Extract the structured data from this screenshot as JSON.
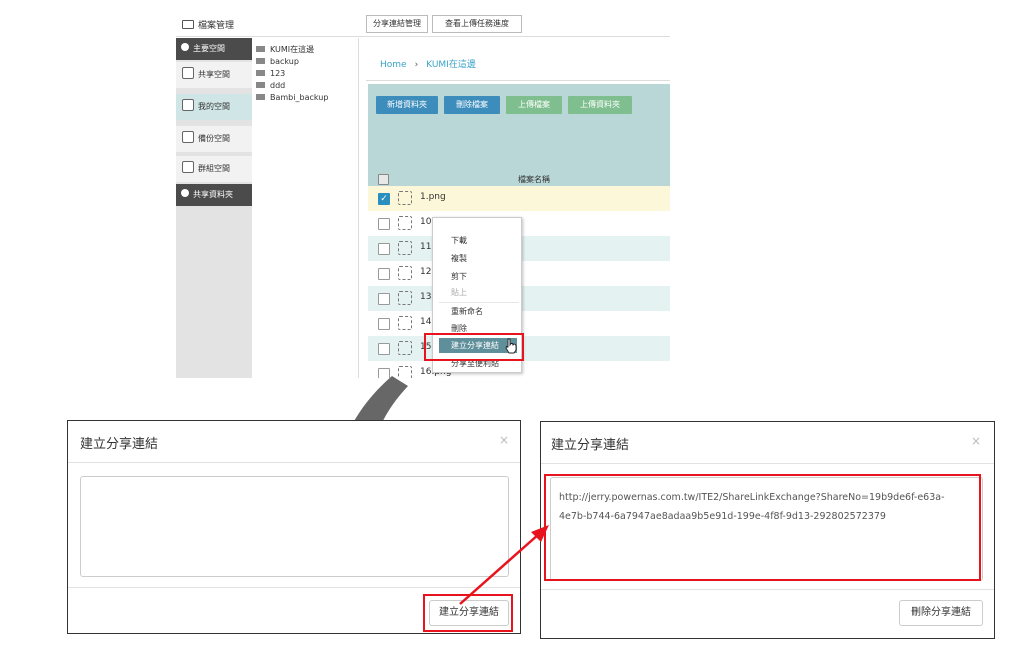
{
  "file_manager": {
    "title": "檔案管理",
    "top_buttons": [
      "分享連結管理",
      "查看上傳任務進度"
    ],
    "sidebar": [
      {
        "label": "主要空間",
        "icon": "pie-chart-icon",
        "style": "dark"
      },
      {
        "label": "共享空間",
        "icon": "globe-icon",
        "style": "light"
      },
      {
        "label": "我的空間",
        "icon": "home-icon",
        "style": "selected"
      },
      {
        "label": "備份空間",
        "icon": "history-icon",
        "style": "light"
      },
      {
        "label": "群組空間",
        "icon": "group-icon",
        "style": "light"
      },
      {
        "label": "共享資料夾",
        "icon": "pie-chart-icon",
        "style": "dark"
      }
    ],
    "tree": [
      "KUMI在這邊",
      "backup",
      "123",
      "ddd",
      "Bambi_backup"
    ],
    "breadcrumb": [
      "Home",
      "KUMI在這邊"
    ],
    "breadcrumb_sep": "›",
    "toolbar": [
      "新增資料夾",
      "刪除檔案",
      "上傳檔案",
      "上傳資料夾"
    ],
    "column_header": "檔案名稱",
    "files": [
      {
        "name": "1.png",
        "checked": true
      },
      {
        "name": "10",
        "checked": false
      },
      {
        "name": "11",
        "checked": false
      },
      {
        "name": "12",
        "checked": false
      },
      {
        "name": "13",
        "checked": false
      },
      {
        "name": "14",
        "checked": false
      },
      {
        "name": "15",
        "checked": false
      },
      {
        "name": "16.png",
        "checked": false
      }
    ],
    "context_menu": [
      "下載",
      "複製",
      "剪下",
      "貼上",
      "重新命名",
      "刪除",
      "建立分享連結",
      "分享至便利貼"
    ],
    "checkmark": "✓"
  },
  "dialog_empty": {
    "title": "建立分享連結",
    "close": "×",
    "button": "建立分享連結"
  },
  "dialog_result": {
    "title": "建立分享連結",
    "close": "×",
    "url_line1": "http://jerry.powernas.com.tw/ITE2/ShareLinkExchange?ShareNo=19b9de6f-e63a-",
    "url_line2": "4e7b-b744-6a7947ae8adaa9b5e91d-199e-4f8f-9d13-292802572379",
    "button": "刪除分享連結"
  },
  "colors": {
    "highlight_red": "#e8141d",
    "toolbar_blue": "#3c8dbc",
    "toolbar_green": "#7fbf8f",
    "selected_row": "#fdf7d9",
    "striped_row": "#e4f2f2",
    "arrow_gray": "#5f5f5f"
  }
}
